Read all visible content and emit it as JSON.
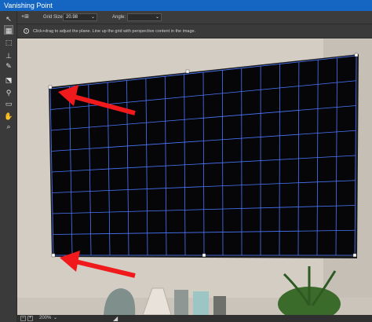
{
  "window": {
    "title": "Vanishing Point"
  },
  "options": {
    "grid_size_label": "Grid Size:",
    "grid_size_value": "20.98",
    "angle_label": "Angle:",
    "angle_value": ""
  },
  "info": {
    "message": "Click+drag to adjust the plane. Line up the grid with perspective content in the image."
  },
  "status": {
    "zoom": "200%"
  },
  "tools": [
    {
      "name": "edit-plane-tool",
      "icon": "arrow-pointer-icon",
      "glyph": "↖"
    },
    {
      "name": "create-plane-tool",
      "icon": "grid-plane-icon",
      "glyph": "▦"
    },
    {
      "name": "marquee-tool",
      "icon": "marquee-icon",
      "glyph": "⬚"
    },
    {
      "name": "stamp-tool",
      "icon": "stamp-icon",
      "glyph": "⊥"
    },
    {
      "name": "brush-tool",
      "icon": "brush-icon",
      "glyph": "✎"
    },
    {
      "name": "transform-tool",
      "icon": "transform-icon",
      "glyph": "⬔"
    },
    {
      "name": "eyedropper-tool",
      "icon": "eyedropper-icon",
      "glyph": "⚲"
    },
    {
      "name": "measure-tool",
      "icon": "ruler-icon",
      "glyph": "▭"
    },
    {
      "name": "hand-tool",
      "icon": "hand-icon",
      "glyph": "✋"
    },
    {
      "name": "zoom-tool",
      "icon": "magnifier-icon",
      "glyph": "⌕"
    }
  ],
  "colors": {
    "title_bar": "#1566c2",
    "grid_lines": "#4a78ff",
    "arrow": "#f0191c",
    "screen": "#060608"
  }
}
